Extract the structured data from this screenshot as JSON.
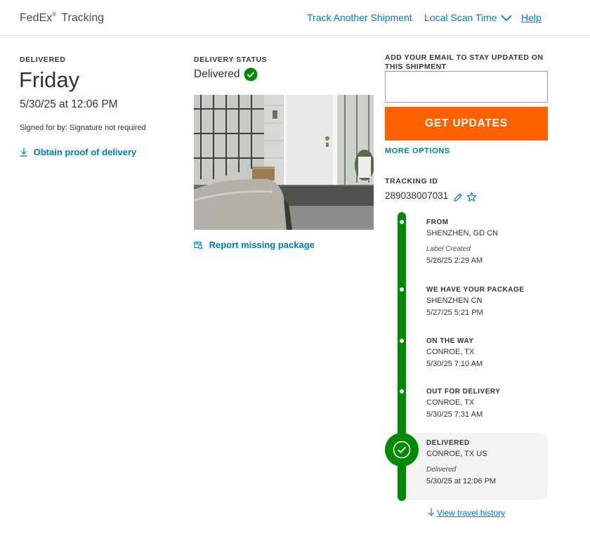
{
  "header": {
    "brand": "FedEx",
    "brand_reg": "®",
    "title": "Tracking",
    "links": {
      "track_another": "Track Another Shipment",
      "local_scan_time": "Local Scan Time",
      "help": "Help"
    }
  },
  "summary": {
    "label": "DELIVERED",
    "day": "Friday",
    "datetime": "5/30/25 at 12:06 PM",
    "signed_for": "Signed for by: Signature not required",
    "proof_link": "Obtain proof of delivery"
  },
  "delivery_status": {
    "label": "DELIVERY STATUS",
    "status": "Delivered",
    "report_link": "Report missing package"
  },
  "updates": {
    "email_label": "ADD YOUR EMAIL TO STAY UPDATED ON THIS SHIPMENT",
    "email_value": "",
    "button": "GET UPDATES",
    "more_options": "MORE OPTIONS"
  },
  "tracking": {
    "label": "TRACKING ID",
    "id": "289038007031"
  },
  "timeline": [
    {
      "title": "FROM",
      "location": "SHENZHEN, GD CN",
      "note": "Label Created",
      "time": "5/26/25 2:29 AM"
    },
    {
      "title": "WE HAVE YOUR PACKAGE",
      "location": "SHENZHEN CN",
      "note": "",
      "time": "5/27/25 5:21 PM"
    },
    {
      "title": "ON THE WAY",
      "location": "CONROE, TX",
      "note": "",
      "time": "5/30/25 7:10 AM"
    },
    {
      "title": "OUT FOR DELIVERY",
      "location": "CONROE, TX",
      "note": "",
      "time": "5/30/25 7:31 AM"
    },
    {
      "title": "DELIVERED",
      "location": "CONROE, TX US",
      "note": "Delivered",
      "time": "5/30/25 at 12:06 PM"
    }
  ],
  "travel_history_link": "View travel history",
  "colors": {
    "fedex_blue": "#007ab7",
    "accent_orange": "#ff6200",
    "timeline_green": "#008a00"
  }
}
